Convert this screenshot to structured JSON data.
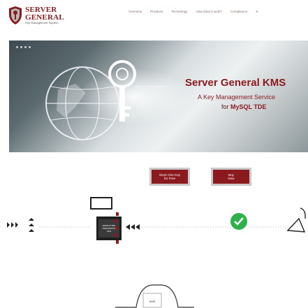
{
  "brand": {
    "line1": "SERVER",
    "line2": "GENERAL",
    "tagline": "Key Management System",
    "color": "#8b1a1f"
  },
  "nav": {
    "items": [
      "Overview",
      "Products",
      "Technology",
      "How does it work?",
      "Compliance",
      "S"
    ]
  },
  "hero": {
    "title": "Server General KMS",
    "subtitle": "A Key Management Service",
    "subtitle2_prefix": "for ",
    "subtitle2_emph": "MySQL TDE",
    "icons": [
      "key-icon",
      "globe-icon"
    ]
  },
  "buttons": {
    "store_line1": "Store One Key",
    "store_line2": "for Free",
    "buy_line1": "Buy",
    "buy_line2": "Now"
  },
  "diagram": {
    "table_label_line1": "ENCRYPTED",
    "table_label_line2": "TABLESPACE",
    "table_label_line3": "FILE",
    "status_color": "#2fb14a",
    "server_label": "KMS"
  }
}
